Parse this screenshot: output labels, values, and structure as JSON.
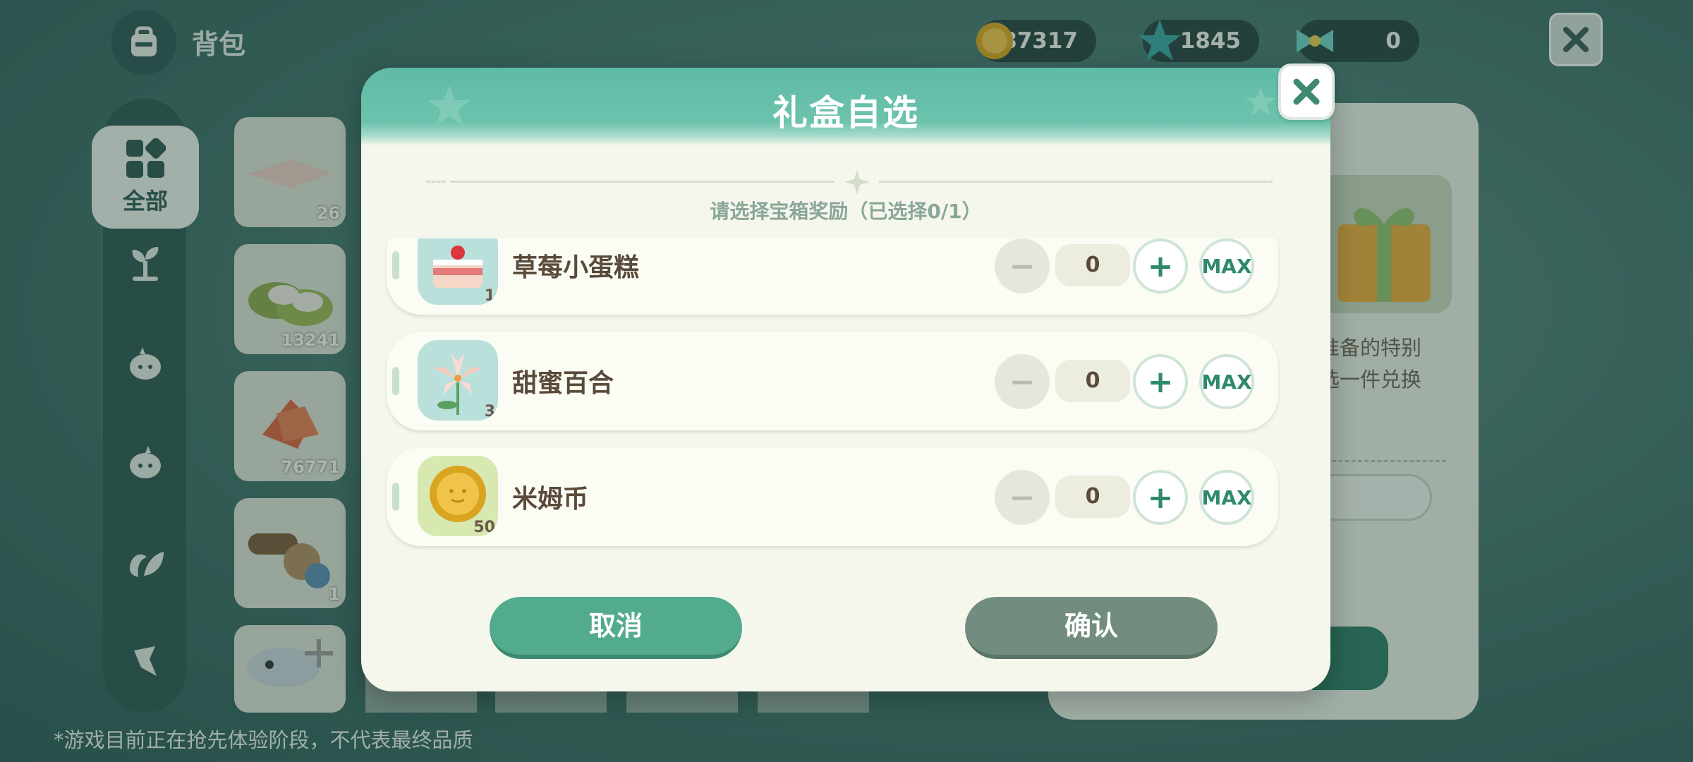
{
  "header": {
    "title": "背包",
    "currencies": [
      {
        "name": "gold-coin",
        "value": "87317"
      },
      {
        "name": "star-gem",
        "value": "1845"
      },
      {
        "name": "ribbon-ticket",
        "value": "0"
      }
    ]
  },
  "sidebar": {
    "active_label": "全部",
    "icons": [
      "grid-icon",
      "sprout-icon",
      "creature-icon",
      "creature-alt-icon",
      "leaf-icon",
      "bird-icon"
    ]
  },
  "grid_counts": [
    "26",
    "13241",
    "76771",
    "1",
    ""
  ],
  "detail": {
    "line1": "准备的特别",
    "line2": "选一件兑换"
  },
  "disclaimer": "*游戏目前正在抢先体验阶段，不代表最终品质",
  "modal": {
    "title": "礼盒自选",
    "prompt": "请选择宝箱奖励（已选择0/1）",
    "items": [
      {
        "name": "草莓小蛋糕",
        "count": "1",
        "qty": "0",
        "minus": "−",
        "plus": "+",
        "max": "MAX",
        "icon": "strawberry-cake-icon"
      },
      {
        "name": "甜蜜百合",
        "count": "3",
        "qty": "0",
        "minus": "−",
        "plus": "+",
        "max": "MAX",
        "icon": "lily-icon"
      },
      {
        "name": "米姆币",
        "count": "50",
        "qty": "0",
        "minus": "−",
        "plus": "+",
        "max": "MAX",
        "icon": "mim-coin-icon"
      }
    ],
    "cancel_label": "取消",
    "confirm_label": "确认"
  },
  "colors": {
    "accent": "#52ab8c",
    "header_teal": "#5fbba6",
    "confirm_gray": "#728d80",
    "panel_bg": "#f5f6ec"
  }
}
